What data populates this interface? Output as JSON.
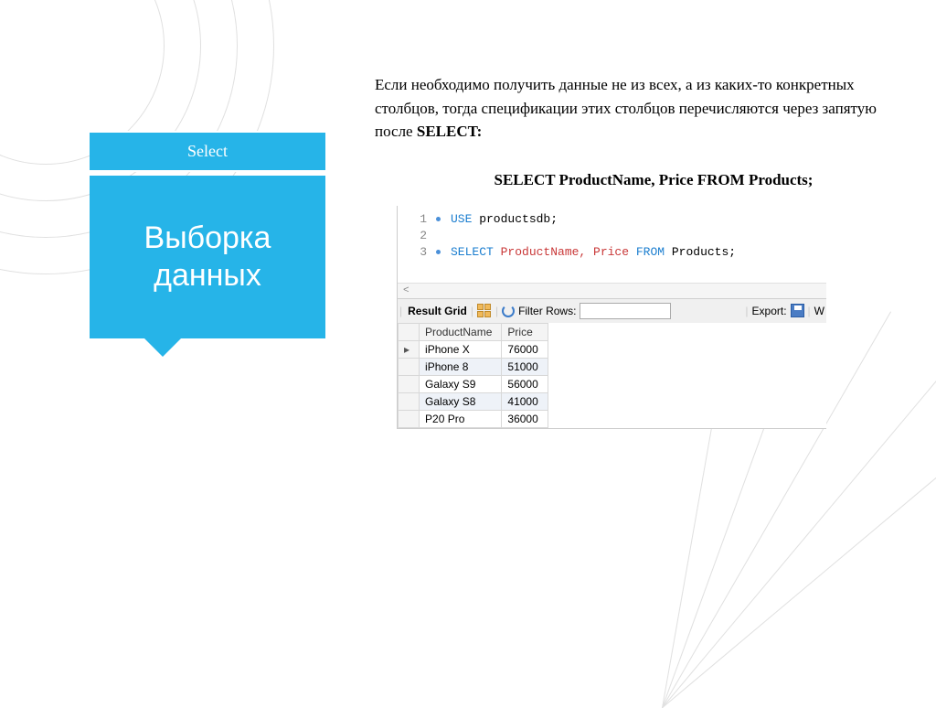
{
  "sidebar": {
    "header": "Select",
    "body_line1": "Выборка",
    "body_line2": "данных"
  },
  "description": {
    "text_pre": "Если необходимо получить данные не из всех, а из каких-то конкретных столбцов, тогда спецификации этих столбцов перечисляются через запятую после ",
    "text_bold": "SELECT:"
  },
  "query_heading": "SELECT ProductName, Price FROM Products;",
  "code": {
    "lines": [
      "1",
      "2",
      "3"
    ],
    "markers": [
      true,
      false,
      true
    ],
    "line1": {
      "kw": "USE",
      "rest": " productsdb;"
    },
    "line3": {
      "kw1": "SELECT",
      "mid": " ProductName, Price ",
      "kw2": "FROM",
      "rest": " Products;"
    }
  },
  "resultbar": {
    "label": "Result Grid",
    "filter_label": "Filter Rows:",
    "export_label": "Export:",
    "trailing": "W"
  },
  "table": {
    "columns": [
      "ProductName",
      "Price"
    ],
    "rows": [
      {
        "name": "iPhone X",
        "price": "76000"
      },
      {
        "name": "iPhone 8",
        "price": "51000"
      },
      {
        "name": "Galaxy S9",
        "price": "56000"
      },
      {
        "name": "Galaxy S8",
        "price": "41000"
      },
      {
        "name": "P20 Pro",
        "price": "36000"
      }
    ]
  }
}
